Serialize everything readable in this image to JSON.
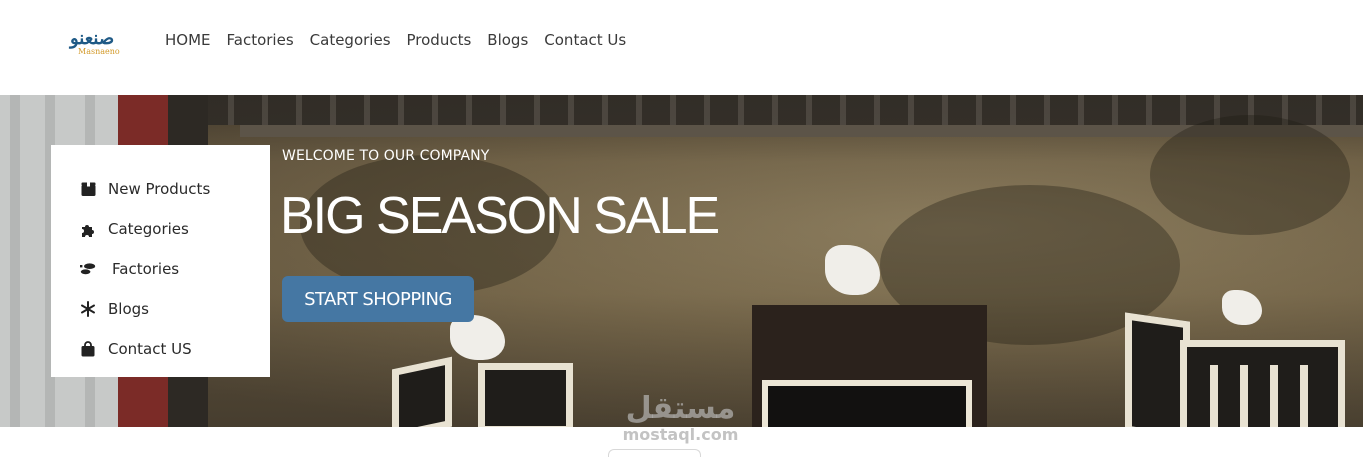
{
  "brand": {
    "logo_ar": "صنعنو",
    "logo_en": "Masnaeno"
  },
  "nav": {
    "items": [
      "HOME",
      "Factories",
      "Categories",
      "Products",
      "Blogs",
      "Contact Us"
    ]
  },
  "side_menu": {
    "items": [
      {
        "label": "New Products",
        "icon": "box-icon"
      },
      {
        "label": "Categories",
        "icon": "puzzle-icon"
      },
      {
        "label": "Factories",
        "icon": "shoe-prints-icon"
      },
      {
        "label": "Blogs",
        "icon": "snowflake-icon"
      },
      {
        "label": "Contact US",
        "icon": "shopping-bag-icon"
      }
    ]
  },
  "hero": {
    "welcome": "WELCOME TO OUR COMPANY",
    "title": "BIG SEASON SALE",
    "cta_label": "START SHOPPING"
  },
  "watermark": {
    "ar": "مستقل",
    "en": "mostaql.com"
  },
  "colors": {
    "accent": "#4577a3",
    "nav_text": "#3a3a3a"
  }
}
